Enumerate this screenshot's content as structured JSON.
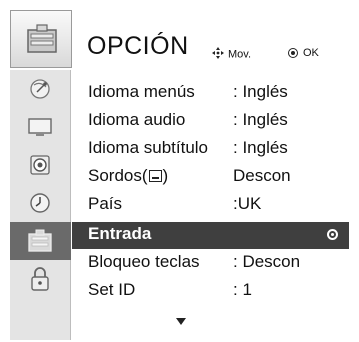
{
  "header": {
    "title": "OPCIÓN",
    "hint_move_label": "Mov.",
    "hint_ok_label": "OK",
    "icons": {
      "move": "four-way-arrow-icon",
      "ok": "ok-circle-icon"
    }
  },
  "sidebar": {
    "top_icon": "option-menu-icon",
    "items": [
      {
        "icon": "satellite-dish-icon",
        "selected": false
      },
      {
        "icon": "monitor-icon",
        "selected": false
      },
      {
        "icon": "speaker-icon",
        "selected": false
      },
      {
        "icon": "clock-icon",
        "selected": false
      },
      {
        "icon": "option-menu-icon",
        "selected": true
      },
      {
        "icon": "lock-icon",
        "selected": false
      }
    ]
  },
  "menu": {
    "items": [
      {
        "label": "Idioma menús",
        "value": ": Inglés"
      },
      {
        "label": "Idioma audio",
        "value": ": Inglés"
      },
      {
        "label": "Idioma subtítulo",
        "value": ": Inglés"
      },
      {
        "label_prefix": "Sordos(",
        "label_suffix": ")",
        "label_icon": "closed-caption-icon",
        "value": "Descon"
      },
      {
        "label": "País",
        "value": ":UK"
      },
      {
        "label": "Entrada",
        "value": "",
        "highlighted": true
      },
      {
        "label": "Bloqueo teclas",
        "value": ": Descon"
      },
      {
        "label": "Set ID",
        "value": ": 1"
      }
    ],
    "scroll_indicator": "scroll-down-arrow-icon"
  },
  "colors": {
    "highlight_bg": "#3f3f3f",
    "sidebar_bg": "#e4e4e4",
    "sidebar_selected_bg": "#6a6a6a"
  }
}
